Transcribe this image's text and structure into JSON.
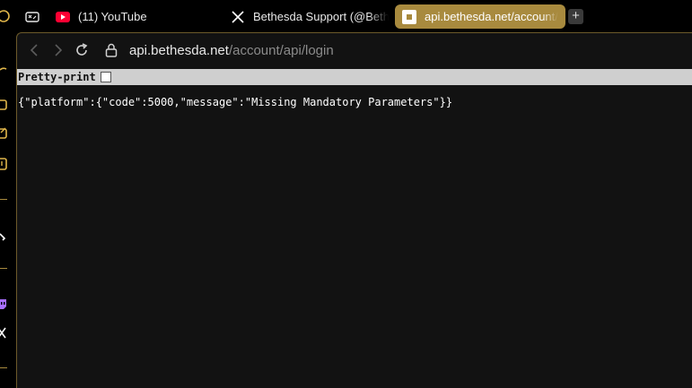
{
  "tabs": [
    {
      "title": "",
      "icon": "gamepad-icon"
    },
    {
      "title": "(11) YouTube",
      "icon": "youtube-icon"
    },
    {
      "title": "Bethesda Support (@Beth",
      "icon": "x-logo-icon"
    },
    {
      "title": "api.bethesda.net/account/",
      "icon": "bethesda-icon",
      "active": true
    }
  ],
  "new_tab_label": "+",
  "address": {
    "host": "api.bethesda.net",
    "path": "/account/api/login"
  },
  "pretty_print": {
    "label": "Pretty-print",
    "checked": false
  },
  "json_text": "{\"platform\":{\"code\":5000,\"message\":\"Missing Mandatory Parameters\"}}",
  "colors": {
    "accent": "#a88a3e",
    "background": "#121212"
  }
}
